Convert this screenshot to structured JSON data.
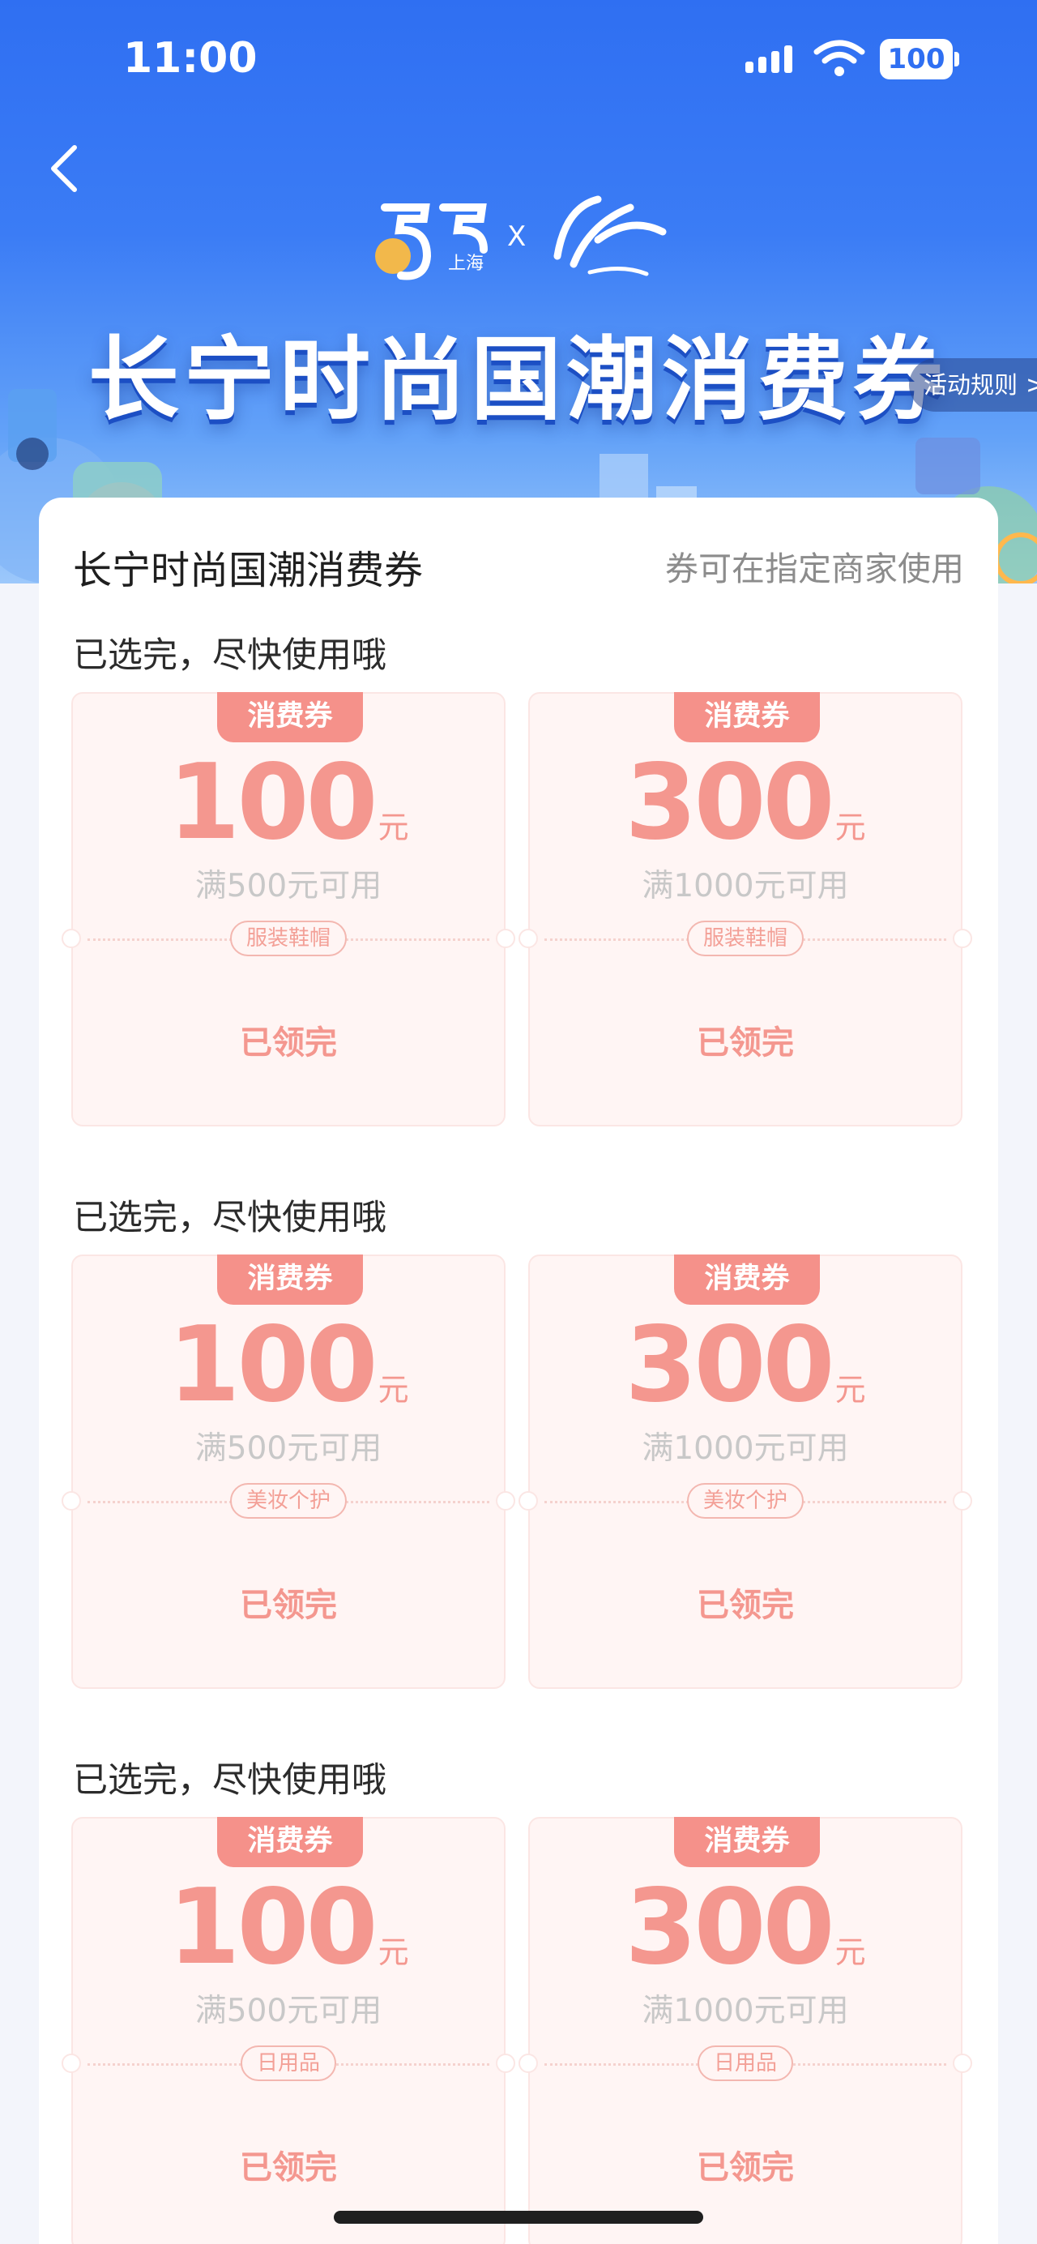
{
  "status_bar": {
    "time": "11:00",
    "battery": "100"
  },
  "header": {
    "logo_left_text": "上海",
    "logo_x": "X",
    "title": "长宁时尚国潮消费券",
    "rules_label": "活动规则",
    "rules_arrow": ">"
  },
  "card": {
    "title": "长宁时尚国潮消费券",
    "subtitle": "券可在指定商家使用"
  },
  "groups": [
    {
      "label": "已选完，尽快使用哦",
      "coupons": [
        {
          "tag": "消费券",
          "amount": "100",
          "unit": "元",
          "threshold": "满500元可用",
          "category": "服装鞋帽",
          "status": "已领完"
        },
        {
          "tag": "消费券",
          "amount": "300",
          "unit": "元",
          "threshold": "满1000元可用",
          "category": "服装鞋帽",
          "status": "已领完"
        }
      ]
    },
    {
      "label": "已选完，尽快使用哦",
      "coupons": [
        {
          "tag": "消费券",
          "amount": "100",
          "unit": "元",
          "threshold": "满500元可用",
          "category": "美妆个护",
          "status": "已领完"
        },
        {
          "tag": "消费券",
          "amount": "300",
          "unit": "元",
          "threshold": "满1000元可用",
          "category": "美妆个护",
          "status": "已领完"
        }
      ]
    },
    {
      "label": "已选完，尽快使用哦",
      "coupons": [
        {
          "tag": "消费券",
          "amount": "100",
          "unit": "元",
          "threshold": "满500元可用",
          "category": "日用品",
          "status": "已领完"
        },
        {
          "tag": "消费券",
          "amount": "300",
          "unit": "元",
          "threshold": "满1000元可用",
          "category": "日用品",
          "status": "已领完"
        }
      ]
    }
  ],
  "colors": {
    "hero_blue": "#2f6ff2",
    "coupon_accent": "#f4978f",
    "coupon_bg": "#fff5f4"
  }
}
